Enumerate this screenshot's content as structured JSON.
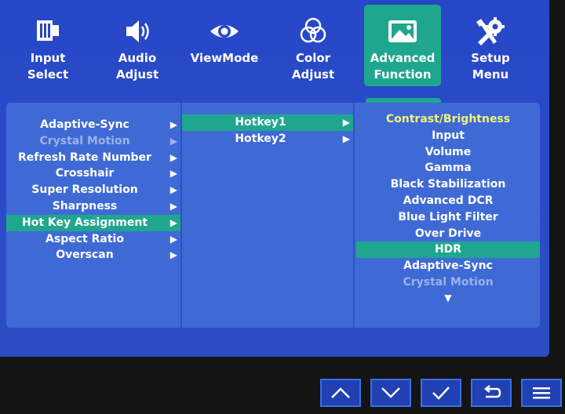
{
  "tabs": [
    {
      "label_line1": "Input",
      "label_line2": "Select",
      "icon": "input-select-icon"
    },
    {
      "label_line1": "Audio",
      "label_line2": "Adjust",
      "icon": "speaker-icon"
    },
    {
      "label_line1": "ViewMode",
      "label_line2": "",
      "icon": "eye-icon"
    },
    {
      "label_line1": "Color",
      "label_line2": "Adjust",
      "icon": "color-circles-icon"
    },
    {
      "label_line1": "Advanced",
      "label_line2": "Function",
      "icon": "advanced-function-icon",
      "active": true
    },
    {
      "label_line1": "Setup Menu",
      "label_line2": "",
      "icon": "tools-icon"
    }
  ],
  "menu": [
    {
      "label": "Adaptive-Sync",
      "arrow": "▶"
    },
    {
      "label": "Crystal Motion",
      "arrow": "▶",
      "disabled": true
    },
    {
      "label": "Refresh Rate Number",
      "arrow": "▶"
    },
    {
      "label": "Crosshair",
      "arrow": "▶"
    },
    {
      "label": "Super Resolution",
      "arrow": "▶"
    },
    {
      "label": "Sharpness",
      "arrow": "▶"
    },
    {
      "label": "Hot Key Assignment",
      "arrow": "▶",
      "selected": true
    },
    {
      "label": "Aspect Ratio",
      "arrow": "▶"
    },
    {
      "label": "Overscan",
      "arrow": "▶"
    }
  ],
  "submenu": [
    {
      "label": "Hotkey1",
      "arrow": "▶",
      "selected": true
    },
    {
      "label": "Hotkey2",
      "arrow": "▶"
    }
  ],
  "options": [
    {
      "label": "Contrast/Brightness",
      "highlight": true
    },
    {
      "label": "Input"
    },
    {
      "label": "Volume"
    },
    {
      "label": "Gamma"
    },
    {
      "label": "Black Stabilization"
    },
    {
      "label": "Advanced DCR"
    },
    {
      "label": "Blue Light Filter"
    },
    {
      "label": "Over Drive"
    },
    {
      "label": "HDR",
      "selected": true
    },
    {
      "label": "Adaptive-Sync"
    },
    {
      "label": "Crystal Motion",
      "disabled": true
    }
  ],
  "options_more": "▼",
  "buttons": [
    {
      "name": "up-button",
      "icon": "chevron-up-icon"
    },
    {
      "name": "down-button",
      "icon": "chevron-down-icon"
    },
    {
      "name": "confirm-button",
      "icon": "checkmark-icon"
    },
    {
      "name": "back-button",
      "icon": "return-icon"
    },
    {
      "name": "menu-button",
      "icon": "hamburger-icon"
    }
  ],
  "colors": {
    "background": "#2647c8",
    "panel": "#3f6ad6",
    "selected": "#1fa68e",
    "highlight_text": "#f2f279",
    "disabled_text": "#9cb2ea"
  }
}
